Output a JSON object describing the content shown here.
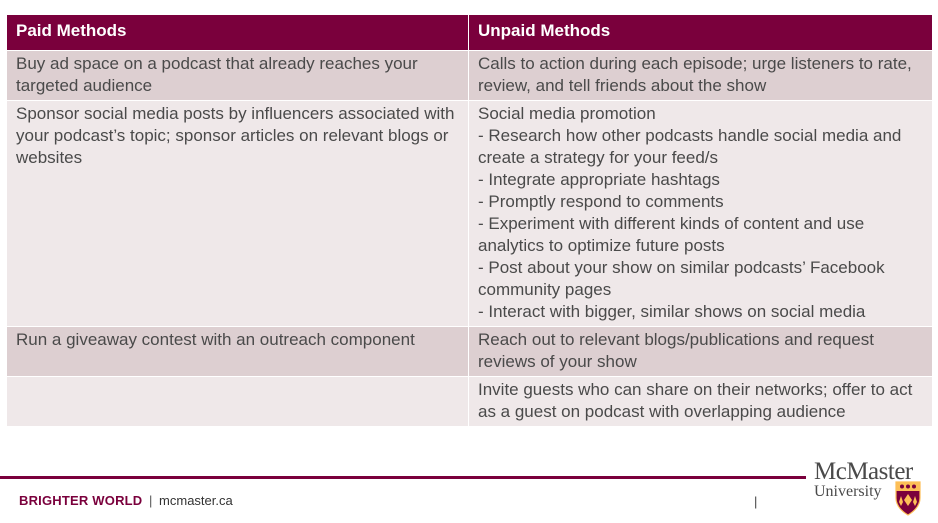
{
  "table": {
    "headers": [
      "Paid Methods",
      "Unpaid Methods"
    ],
    "rows": [
      {
        "paid": [
          "Buy ad space on a podcast that already reaches your targeted audience"
        ],
        "unpaid": [
          "Calls to action during each episode; urge listeners to rate, review, and tell friends about the show"
        ]
      },
      {
        "paid": [
          "Sponsor social media posts by influencers associated with your podcast’s topic; sponsor articles on relevant blogs or websites"
        ],
        "unpaid": [
          "Social media promotion",
          "- Research how other podcasts handle social media and create a strategy for your feed/s",
          "- Integrate appropriate hashtags",
          "- Promptly respond to comments",
          "- Experiment with different kinds of content and use analytics to optimize future posts",
          "- Post about your show on similar podcasts’ Facebook community pages",
          "- Interact with bigger, similar shows on social media"
        ]
      },
      {
        "paid": [
          "Run a giveaway contest with an outreach component"
        ],
        "unpaid": [
          "Reach out to relevant blogs/publications and request reviews of your show"
        ]
      },
      {
        "paid": [],
        "unpaid": [
          "Invite guests who can share on their networks; offer to act as a guest on podcast with overlapping audience"
        ]
      }
    ]
  },
  "footer": {
    "brand": "BRIGHTER WORLD",
    "separator": "|",
    "site": "mcmaster.ca",
    "pipe": "|"
  },
  "logo": {
    "line1": "McMaster",
    "line2": "University",
    "crest_icon": "mcmaster-crest-icon"
  },
  "colors": {
    "header_bg": "#7a003c",
    "row_dark": "#ddcfd1",
    "row_light": "#efe8e9",
    "accent_rule": "#7a003c"
  }
}
